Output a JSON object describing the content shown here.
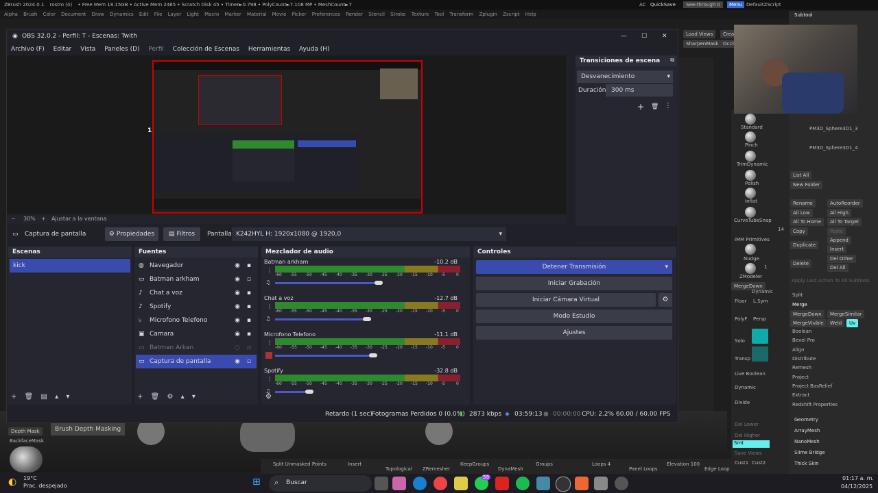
{
  "zbrush": {
    "top_items": [
      "ZBrush 2024.0.1",
      "rostro (4)",
      "• Free Mem 18.15GB • Active Mem 2465 • Scratch Disk 45 • Timer►0.798 • PolyCount►7.108 MP • MeshCount►7"
    ],
    "top_right": [
      "AC",
      "QuickSave",
      "See-through  0",
      "Menu",
      "DefaultZScript"
    ],
    "menus": [
      "Alpha",
      "Brush",
      "Color",
      "Document",
      "Draw",
      "Dynamics",
      "Edit",
      "File",
      "Layer",
      "Light",
      "Macro",
      "Marker",
      "Material",
      "Movie",
      "Picker",
      "Preferences",
      "Render",
      "Stencil",
      "Stroke",
      "Texture",
      "Tool",
      "Transform",
      "Zplugin",
      "Zscript",
      "Help"
    ],
    "subtool": "Subtool",
    "load_views": "Load Views",
    "creas": "Creas",
    "sharpen": "SharpenMask",
    "occlu": "Occlu",
    "mesh1": "PM3D_Sphere3D1_3",
    "mesh2": "PM3D_Sphere3D1_4",
    "brushes": [
      "Standard",
      "Pinch",
      "TrimDynamic",
      "Polish",
      "Inflat",
      "CurveTubeSnap",
      "IMM Primitives",
      "Nudge",
      "ZModeler"
    ],
    "brush_count": "14",
    "zmodeler_count": "1",
    "list_btns": [
      "List All",
      "New Folder",
      "Rename",
      "AutoReorder",
      "All Low",
      "All High",
      "All To Home",
      "All To Target",
      "Copy",
      "Paste",
      "Duplicate",
      "Append",
      "Insert",
      "Delete",
      "Del Other",
      "Del All"
    ],
    "apply_last": "Apply Last Action To All Subtools",
    "split": "Split",
    "merge": "Merge",
    "merge_down": "MergeDown",
    "merge_similar": "MergeSimilar",
    "merge_visible": "MergeVisible",
    "weld": "Weld",
    "uv": "Uv",
    "tool_items": [
      "Boolean",
      "Bevel Pro",
      "Align",
      "Distribute",
      "Remesh",
      "Project",
      "Project BasRelief",
      "Extract",
      "Redshift Properties"
    ],
    "tool_items2": [
      "Geometry",
      "ArrayMesh",
      "NanoMesh",
      "Slime Bridge",
      "Thick Skin"
    ],
    "mid_items": [
      "MergeDown",
      "Dynamic",
      "Floor",
      "L.Sym",
      "PolyF",
      "Persp",
      "Solo",
      "Transp",
      "Live Boolean",
      "Dynamic",
      "Divide",
      "Del Lower",
      "Del Higher",
      "Smt",
      "Save Views",
      "Cust1",
      "Cust2"
    ],
    "depth_mask": "Depth Mask",
    "backface": "BackfaceMask",
    "brush_depth": "Brush Depth Masking",
    "bottom_labels": [
      "Split Unmasked Points",
      "Insert",
      "Topological",
      "ZRemesher",
      "KeepGroups",
      "DynaMesh",
      "Groups",
      "Loops 4",
      "Panel Loops",
      "Elevation 100",
      "Edge Loop"
    ]
  },
  "obs": {
    "title": "OBS 32.0.2 - Perfil: T - Escenas: Twith",
    "menu": [
      "Archivo (F)",
      "Editar",
      "Vista",
      "Paneles (D)",
      "Perfil",
      "Colección de Escenas",
      "Herramientas",
      "Ayuda (H)"
    ],
    "preview_label": "1 px",
    "zoom": "30%",
    "fit": "Ajustar a la ventana",
    "transitions": {
      "title": "Transiciones de escena",
      "value": "Desvanecimiento",
      "duration_label": "Duración",
      "duration": "300 ms"
    },
    "source_bar": {
      "name": "Captura de pantalla",
      "props": "Propiedades",
      "filters": "Filtros",
      "screen_label": "Pantalla",
      "screen_value": "K242HYL H: 1920x1080 @ 1920,0"
    },
    "scenes": {
      "title": "Escenas",
      "items": [
        "kick"
      ]
    },
    "sources": {
      "title": "Fuentes",
      "items": [
        "Navegador",
        "Batman arkham",
        "Chat a voz",
        "Spotify",
        "Microfono Telefono",
        "Camara",
        "Batman Arkan",
        "Captura de pantalla"
      ]
    },
    "mixer": {
      "title": "Mezclador de audio",
      "channels": [
        {
          "name": "Batman arkham",
          "db": "-10.2 dB",
          "level": 0.9
        },
        {
          "name": "Chat a voz",
          "db": "-12.7 dB",
          "level": 0.8
        },
        {
          "name": "Microfono Telefono",
          "db": "-11.1 dB",
          "level": 0.85
        },
        {
          "name": "Spotify",
          "db": "-32.8 dB",
          "level": 0.3
        }
      ],
      "scale": [
        "-60",
        "-55",
        "-50",
        "-45",
        "-40",
        "-35",
        "-30",
        "-25",
        "-20",
        "-15",
        "-10",
        "-5",
        "0"
      ]
    },
    "controls": {
      "title": "Controles",
      "stop": "Detener Transmisión",
      "record": "Iniciar Grabación",
      "vcam": "Iniciar Cámara Virtual",
      "studio": "Modo Estudio",
      "settings": "Ajustes"
    },
    "status": {
      "delay": "Retardo (1 sec)",
      "dropped": "Fotogramas Perdidos 0 (0.0%)",
      "kbps": "2873 kbps",
      "time": "03:59:13",
      "rec": "00:00:00",
      "cpu": "CPU: 2.2%",
      "fps": "60.00 / 60.00 FPS"
    }
  },
  "taskbar": {
    "temp": "19°C",
    "weather": "Prac. despejado",
    "search": "Buscar",
    "time": "01:17 a. m.",
    "date": "04/12/2025",
    "badge": "59"
  }
}
